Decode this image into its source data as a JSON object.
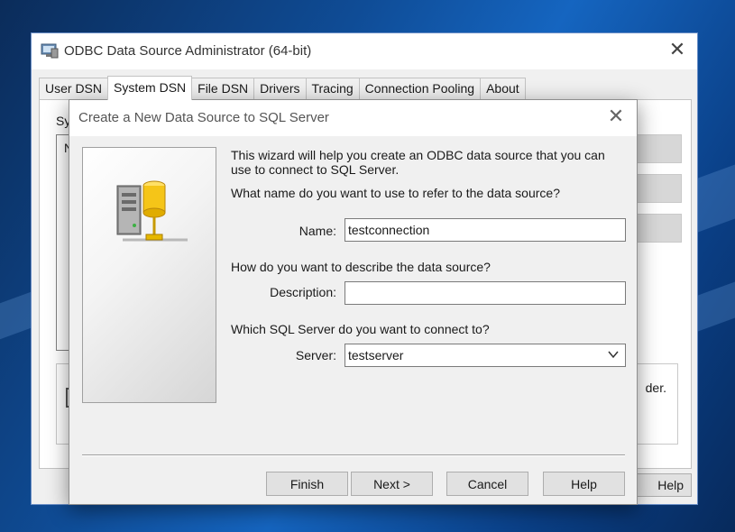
{
  "background_window": {
    "title": "ODBC Data Source Administrator (64-bit)",
    "tabs": [
      "User DSN",
      "System DSN",
      "File DSN",
      "Drivers",
      "Tracing",
      "Connection Pooling",
      "About"
    ],
    "active_tab": "System DSN",
    "panel_label_partial": "Sy",
    "list_header_partial": "N",
    "info_text_partial": "der.",
    "help_label_partial": "Help"
  },
  "dialog": {
    "title": "Create a New Data Source to SQL Server",
    "intro": "This wizard will help you create an ODBC data source that you can use to connect to SQL Server.",
    "name_question": "What name do you want to use to refer to the data source?",
    "name_label": "Name:",
    "name_value": "testconnection",
    "describe_question": "How do you want to describe the data source?",
    "description_label": "Description:",
    "description_value": "",
    "server_question": "Which SQL Server do you want to connect to?",
    "server_label": "Server:",
    "server_value": "testserver",
    "buttons": {
      "finish": "Finish",
      "next": "Next >",
      "cancel": "Cancel",
      "help": "Help"
    }
  },
  "icons": [
    "odbc-app-icon",
    "close-icon",
    "database-server-icon",
    "chevron-down-icon"
  ]
}
